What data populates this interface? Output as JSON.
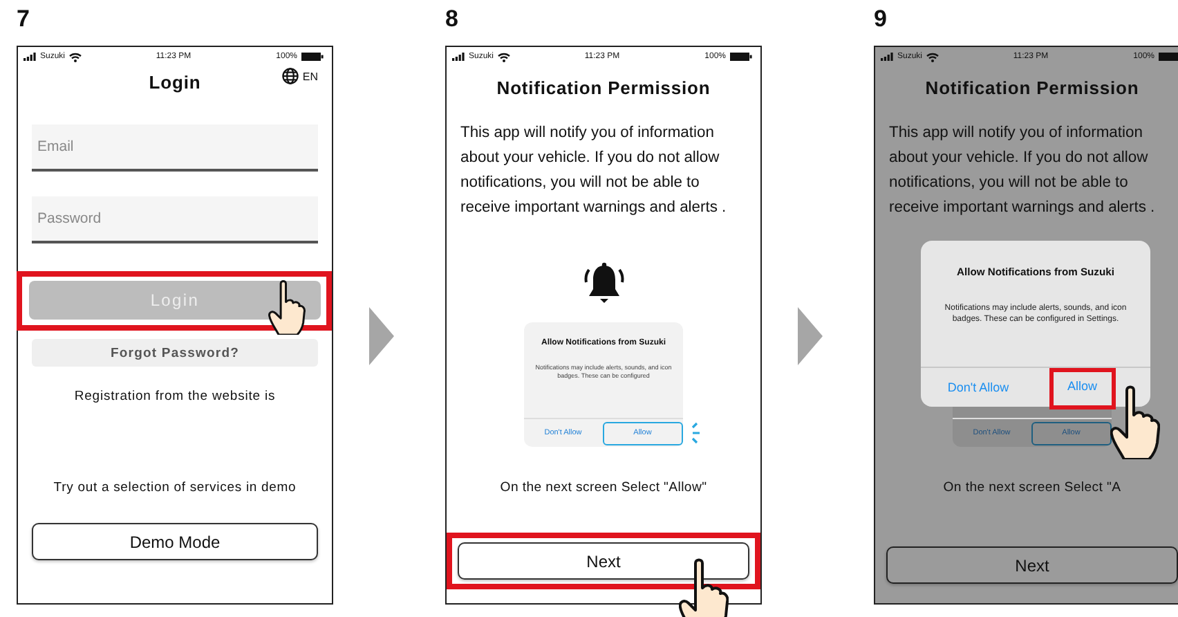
{
  "steps": [
    {
      "number": "7",
      "kind": "login",
      "dimmed": false,
      "status_bar": {
        "carrier": "Suzuki",
        "time": "11:23 PM",
        "battery": "100%"
      },
      "title": "Login",
      "language": "EN",
      "fields": [
        {
          "placeholder": "Email"
        },
        {
          "placeholder": "Password"
        }
      ],
      "login_button": {
        "label": "Login",
        "disabled": true,
        "highlighted": true,
        "tapped": true
      },
      "forgot_button": {
        "label": "Forgot Password?"
      },
      "registration_text": "Registration from the website is",
      "demo_text": "Try out a selection of services in demo",
      "demo_button": {
        "label": "Demo Mode"
      }
    },
    {
      "number": "8",
      "kind": "permission",
      "dimmed": false,
      "status_bar": {
        "carrier": "Suzuki",
        "time": "11:23 PM",
        "battery": "100%"
      },
      "title": "Notification Permission",
      "body": "This app will notify you of information about your vehicle. If you do not allow notifications, you will not be able to receive important warnings and alerts .",
      "preview": {
        "title": "Allow Notifications from Suzuki",
        "message": "Notifications may include alerts, sounds, and icon badges. These can be configured",
        "buttons": [
          {
            "label": "Don't Allow",
            "selected": false
          },
          {
            "label": "Allow",
            "selected": true
          }
        ]
      },
      "hint": "On the next screen Select \"Allow\"",
      "next_button": {
        "label": "Next",
        "highlighted": true,
        "tapped": true
      }
    },
    {
      "number": "9",
      "kind": "permission",
      "dimmed": true,
      "status_bar": {
        "carrier": "Suzuki",
        "time": "11:23 PM",
        "battery": "100%"
      },
      "title": "Notification Permission",
      "body": "This app will notify you of information about your vehicle. If you do not allow notifications, you will not be able to receive important warnings and alerts .",
      "preview": {
        "buttons": [
          {
            "label": "Don't Allow",
            "selected": false
          },
          {
            "label": "Allow",
            "selected": true
          }
        ]
      },
      "hint": "On the next screen Select \"A",
      "next_button": {
        "label": "Next",
        "highlighted": false,
        "tapped": false
      },
      "dialog": {
        "title": "Allow Notifications from Suzuki",
        "message": "Notifications may include alerts, sounds, and icon badges. These can be configured in Settings.",
        "buttons": [
          {
            "label": "Don't Allow",
            "highlighted": false,
            "tapped": false
          },
          {
            "label": "Allow",
            "highlighted": true,
            "tapped": true
          }
        ]
      }
    }
  ]
}
